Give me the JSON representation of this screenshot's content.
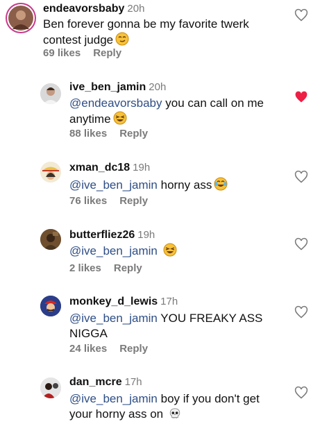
{
  "comments": [
    {
      "username": "endeavorsbaby",
      "time": "20h",
      "text": "Ben forever gonna be my favorite twerk contest judge",
      "emoji": "smirk-face",
      "likes": "69 likes",
      "reply": "Reply",
      "liked": false
    },
    {
      "username": "ive_ben_jamin",
      "time": "20h",
      "mention": "@endeavorsbaby",
      "text": " you can call on me anytime",
      "emoji": "laughing-face",
      "likes": "88 likes",
      "reply": "Reply",
      "liked": true
    },
    {
      "username": "xman_dc18",
      "time": "19h",
      "mention": "@ive_ben_jamin",
      "text": " horny ass",
      "emoji": "crying-laughing-face",
      "likes": "76 likes",
      "reply": "Reply",
      "liked": false
    },
    {
      "username": "butterfliez26",
      "time": "19h",
      "mention": "@ive_ben_jamin",
      "text": "",
      "emoji": "laughing-face",
      "likes": "2 likes",
      "reply": "Reply",
      "liked": false
    },
    {
      "username": "monkey_d_lewis",
      "time": "17h",
      "mention": "@ive_ben_jamin",
      "text": " YOU FREAKY ASS NIGGA",
      "likes": "24 likes",
      "reply": "Reply",
      "liked": false
    },
    {
      "username": "dan_mcre",
      "time": "17h",
      "mention": "@ive_ben_jamin",
      "text": " boy if you don't get your horny ass on",
      "emoji": "skull",
      "liked": false
    }
  ],
  "colors": {
    "mention": "#2e4e86",
    "heart_liked": "#ed1f44",
    "meta_gray": "#7a7a7a"
  }
}
